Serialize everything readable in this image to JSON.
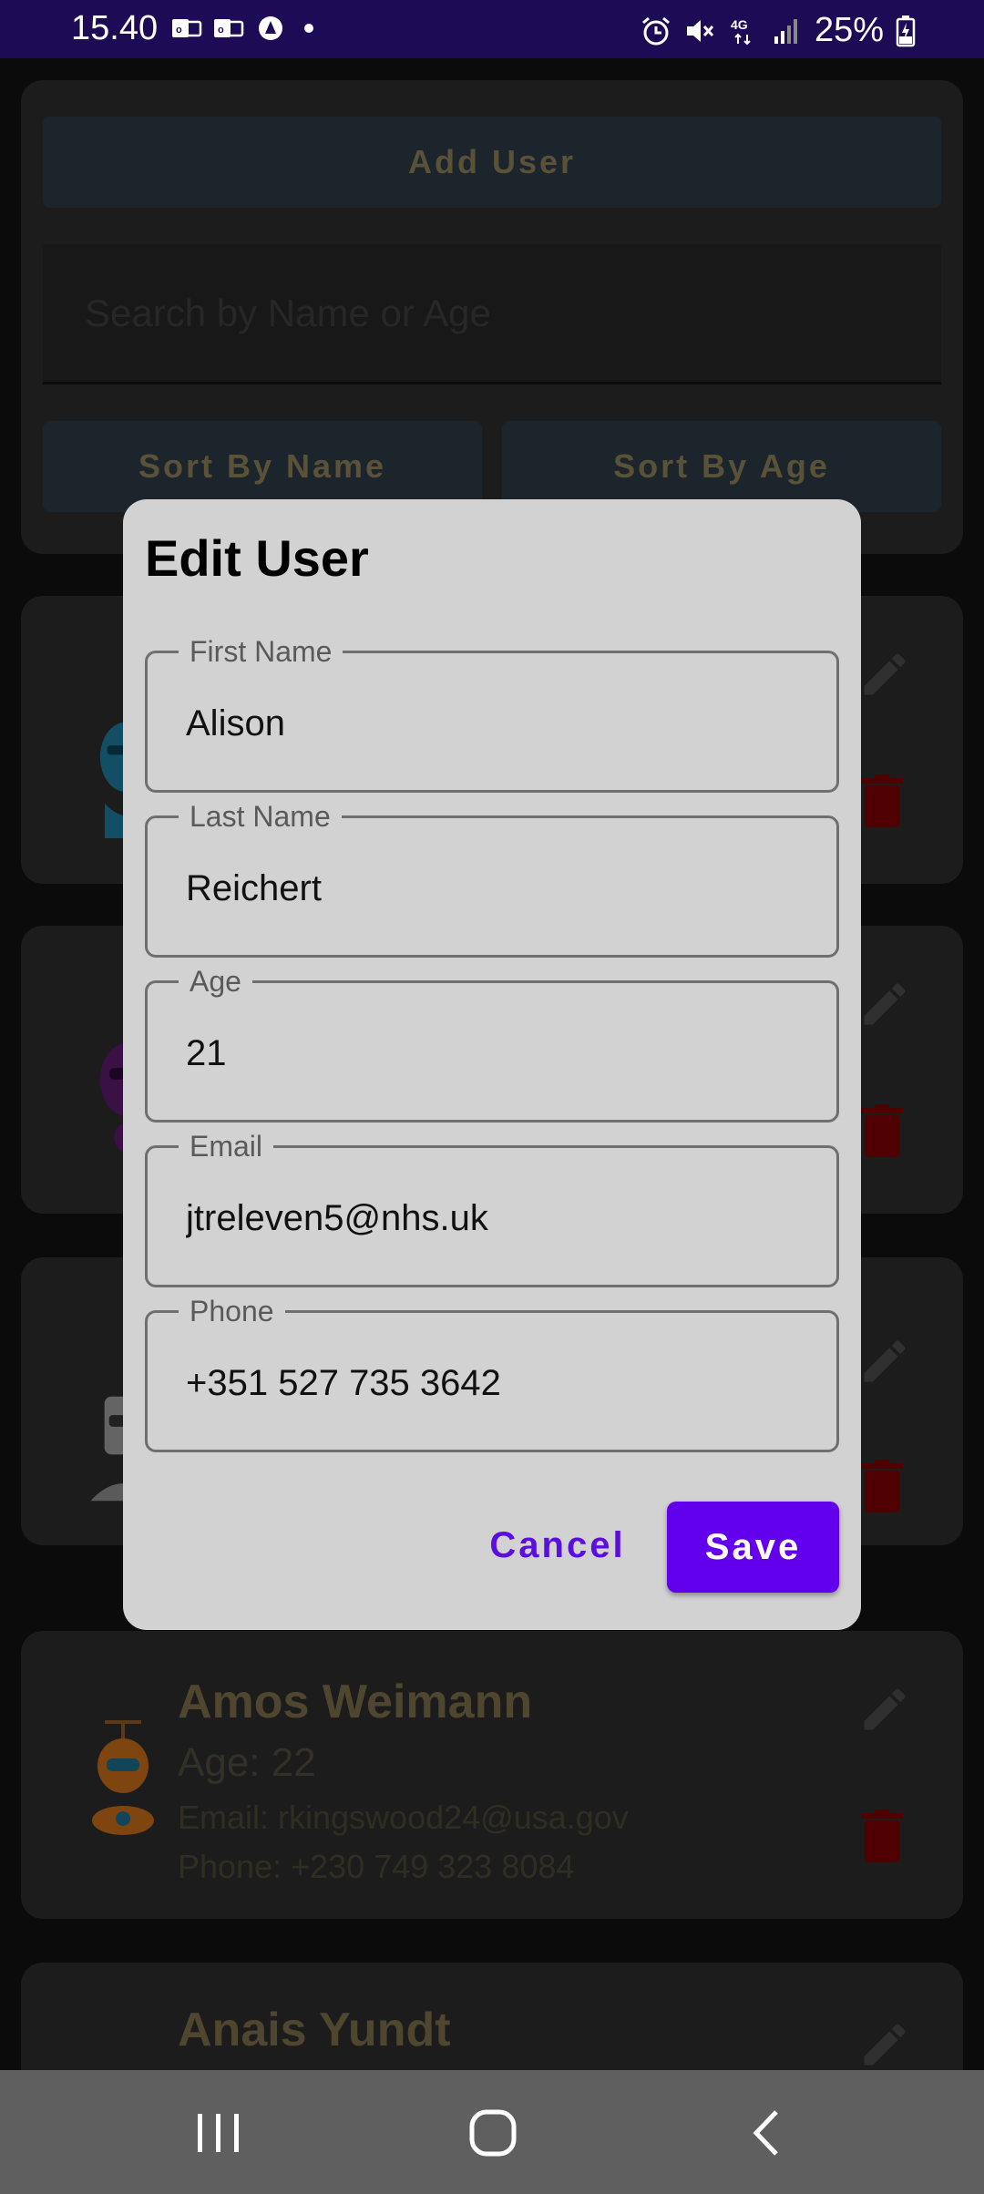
{
  "status_bar": {
    "time": "15.40",
    "battery": "25%",
    "network": "4G",
    "left_icons": [
      "outlook-icon",
      "outlook-icon",
      "app-icon"
    ],
    "right_icons": [
      "alarm-icon",
      "mute-icon",
      "network-4g-icon",
      "signal-icon",
      "battery-charging-icon"
    ]
  },
  "app": {
    "add_user_label": "Add User",
    "search_placeholder": "Search by Name or Age",
    "sort_by_name_label": "Sort By Name",
    "sort_by_age_label": "Sort By Age",
    "users": [
      {
        "name": "Amos Weimann",
        "age": "Age: 22",
        "email": "Email: rkingswood24@usa.gov",
        "phone": "Phone: +230 749 323 8084"
      },
      {
        "name": "Anais Yundt"
      }
    ]
  },
  "dialog": {
    "title": "Edit User",
    "fields": [
      {
        "label": "First Name",
        "value": "Alison"
      },
      {
        "label": "Last Name",
        "value": "Reichert"
      },
      {
        "label": "Age",
        "value": "21"
      },
      {
        "label": "Email",
        "value": "jtreleven5@nhs.uk"
      },
      {
        "label": "Phone",
        "value": "+351 527 735 3642"
      }
    ],
    "cancel_label": "Cancel",
    "save_label": "Save"
  },
  "colors": {
    "status_bar": "#1e0b56",
    "accent": "#6200ee",
    "delete": "#7a0000",
    "dialog_bg": "#d2d2d2"
  },
  "nav_bar": {
    "icons": [
      "recents-icon",
      "home-icon",
      "back-icon"
    ]
  }
}
